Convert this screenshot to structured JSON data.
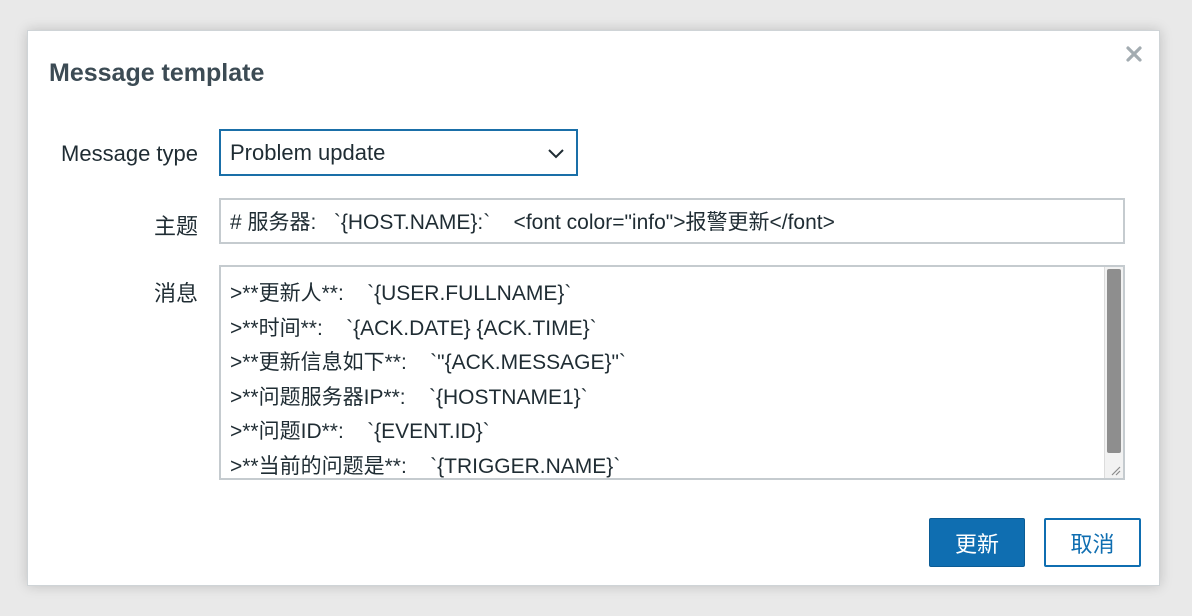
{
  "dialog": {
    "title": "Message template",
    "close_icon": "close-icon",
    "close_symbol": "×"
  },
  "form": {
    "message_type": {
      "label": "Message type",
      "value": "Problem update"
    },
    "subject": {
      "label": "主题",
      "value": "# 服务器:   `{HOST.NAME}:`    <font color=\"info\">报警更新</font>"
    },
    "message": {
      "label": "消息",
      "lines": [
        ">**更新人**:    `{USER.FULLNAME}`",
        ">**时间**:    `{ACK.DATE} {ACK.TIME}`",
        ">**更新信息如下**:    `\"{ACK.MESSAGE}\"`",
        ">**问题服务器IP**:    `{HOSTNAME1}`",
        ">**问题ID**:    `{EVENT.ID}`",
        ">**当前的问题是**:    `{TRIGGER.NAME}`"
      ]
    }
  },
  "buttons": {
    "update_label": "更新",
    "cancel_label": "取消"
  },
  "colors": {
    "primary": "#0f6eb1",
    "focus_border": "#1a6fa8",
    "title_text": "#3c4b54"
  }
}
